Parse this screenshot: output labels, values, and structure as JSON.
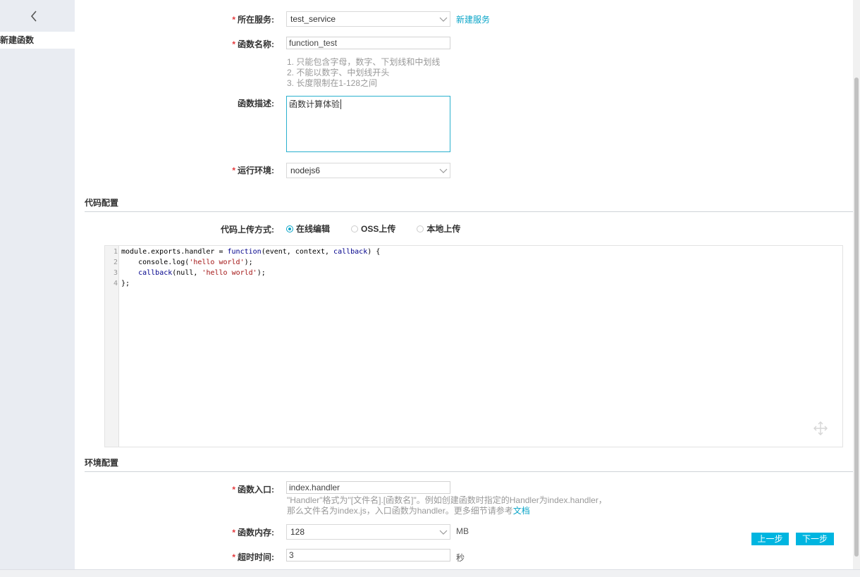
{
  "sidebar": {
    "active_item": "新建函数"
  },
  "form": {
    "service": {
      "label": "所在服务:",
      "value": "test_service",
      "new_link": "新建服务"
    },
    "function_name": {
      "label": "函数名称:",
      "value": "function_test",
      "rules": [
        "1. 只能包含字母，数字、下划线和中划线",
        "2. 不能以数字、中划线开头",
        "3. 长度限制在1-128之间"
      ]
    },
    "description": {
      "label": "函数描述:",
      "value": "函数计算体验"
    },
    "runtime": {
      "label": "运行环境:",
      "value": "nodejs6"
    }
  },
  "code_config": {
    "title": "代码配置",
    "upload_label": "代码上传方式:",
    "options": [
      "在线编辑",
      "OSS上传",
      "本地上传"
    ],
    "selected": "在线编辑",
    "line_numbers": [
      "1",
      "2",
      "3",
      "4"
    ]
  },
  "env_config": {
    "title": "环境配置",
    "handler": {
      "label": "函数入口:",
      "value": "index.handler",
      "hint_line1": "\"Handler\"格式为\"[文件名].[函数名]\"。例如创建函数时指定的Handler为index.handler，",
      "hint_line2": "那么文件名为index.js，入口函数为handler。更多细节请参考",
      "hint_link": "文档"
    },
    "memory": {
      "label": "函数内存:",
      "value": "128",
      "unit": "MB"
    },
    "timeout": {
      "label": "超时时间:",
      "value": "3",
      "unit": "秒"
    }
  },
  "buttons": {
    "prev": "上一步",
    "next": "下一步"
  },
  "colors": {
    "accent": "#00b5e0",
    "link": "#0aa5c8",
    "required": "#e4393c"
  }
}
